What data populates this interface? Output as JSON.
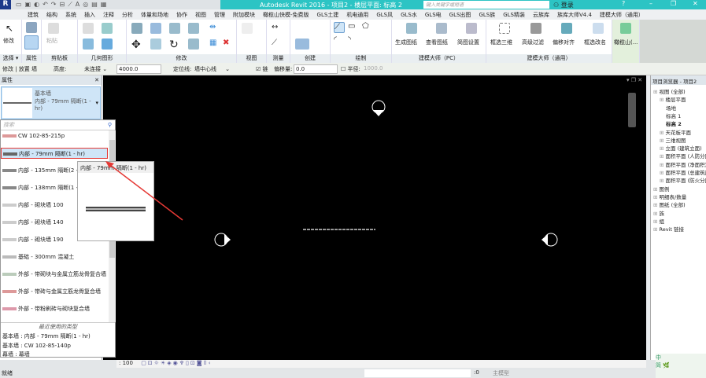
{
  "titlebar": {
    "title": "Autodesk Revit 2016 -    项目2 - 楼层平面: 标高 2",
    "search_placeholder": "键入关键字或短语",
    "login": "登录"
  },
  "tabs": [
    "建筑",
    "结构",
    "系统",
    "插入",
    "注释",
    "分析",
    "体量和场地",
    "协作",
    "视图",
    "管理",
    "附加模块",
    "橄榄山快模-免费版",
    "GLS土建",
    "机电通用",
    "GLS风",
    "GLS水",
    "GLS电",
    "GLS出图",
    "GLS族",
    "GLS精装",
    "云族库",
    "族库大师V4.4",
    "建模大师（通用）"
  ],
  "ribbon": {
    "panels": [
      "选择",
      "属性",
      "剪贴板",
      "几何图形",
      "修改",
      "视图",
      "测量",
      "创建",
      "绘制",
      "建模大师（PC）",
      "建模大师（通用）"
    ],
    "modify": "修改",
    "paste": "粘贴",
    "pc_buttons": [
      "生成图纸",
      "查看图纸",
      "简图设置"
    ],
    "general_buttons": [
      "框选三维",
      "高级过滤",
      "偏移对齐",
      "框选改名"
    ],
    "olive": "橄榄山(..."
  },
  "options": {
    "context": "修改 | 放置 墙",
    "height_label": "高度:",
    "height_mode": "未连接",
    "height_value": "4000.0",
    "locline_label": "定位线:",
    "locline_value": "墙中心线",
    "chain_label": "链",
    "chain_checked": true,
    "offset_label": "偏移量:",
    "offset_value": "0.0",
    "radius_label": "半径:",
    "radius_checked": false,
    "radius_value": "1000.0"
  },
  "properties": {
    "title": "属性",
    "family": "基本墙",
    "type": "内部 - 79mm 隔断(1 - hr)"
  },
  "dropdown": {
    "search_placeholder": "搜索",
    "items": [
      {
        "label": "CW 102-85-215p",
        "color": "#d99"
      },
      {
        "label": "内部 - 79mm 隔断(1 - hr)",
        "color": "#666",
        "selected": true
      },
      {
        "label": "内部 - 135mm 隔断(2 - hr)",
        "color": "#888"
      },
      {
        "label": "内部 - 138mm 隔断(1 - hr)",
        "color": "#888"
      },
      {
        "label": "内部 - 砌块墙 100",
        "color": "#ccc"
      },
      {
        "label": "内部 - 砌块墙 140",
        "color": "#ccc"
      },
      {
        "label": "内部 - 砌块墙 190",
        "color": "#ccc"
      },
      {
        "label": "基础 - 300mm 混凝土",
        "color": "#bbb"
      },
      {
        "label": "外部 - 带砌块与金属立筋龙骨复合墙",
        "color": "#bcb"
      },
      {
        "label": "外部 - 带砖与金属立筋龙骨复合墙",
        "color": "#d99"
      },
      {
        "label": "外部 - 带粉刷砖与砌块复合墙",
        "color": "#d9a"
      }
    ],
    "recent_header": "最近使用的类型",
    "recent": [
      "基本墙 : 内部 - 79mm 隔断(1 - hr)",
      "基本墙 : CW 102-85-140p",
      "幕墙 : 幕墙"
    ]
  },
  "tooltip": {
    "title": "内部 - 79mm 隔断(1 - hr)"
  },
  "browser": {
    "title": "项目浏览器 - 项目2",
    "items": [
      {
        "label": "视图 (全部)",
        "level": 0
      },
      {
        "label": "楼层平面",
        "level": 1
      },
      {
        "label": "场地",
        "level": 2
      },
      {
        "label": "标高 1",
        "level": 2
      },
      {
        "label": "标高 2",
        "level": 2,
        "bold": true
      },
      {
        "label": "天花板平面",
        "level": 1
      },
      {
        "label": "三维视图",
        "level": 1
      },
      {
        "label": "立面 (建筑立面)",
        "level": 1
      },
      {
        "label": "面积平面 (人防分区面积)",
        "level": 1
      },
      {
        "label": "面积平面 (净面积)",
        "level": 1
      },
      {
        "label": "面积平面 (总建筑面积)",
        "level": 1
      },
      {
        "label": "面积平面 (防火分区面积)",
        "level": 1
      },
      {
        "label": "图例",
        "level": 0
      },
      {
        "label": "明细表/数量",
        "level": 0
      },
      {
        "label": "图纸 (全部)",
        "level": 0
      },
      {
        "label": "族",
        "level": 0
      },
      {
        "label": "组",
        "level": 0
      },
      {
        "label": "Revit 链接",
        "level": 0
      }
    ]
  },
  "viewbar": {
    "scale": ": 100"
  },
  "status": {
    "text": "就绪",
    "sel_count": ":0",
    "model": "主模型"
  },
  "colors": {
    "accent": "#2cc4c4",
    "canvas": "#000000",
    "highlight": "#cfe5f7",
    "annotation": "#e53935"
  }
}
